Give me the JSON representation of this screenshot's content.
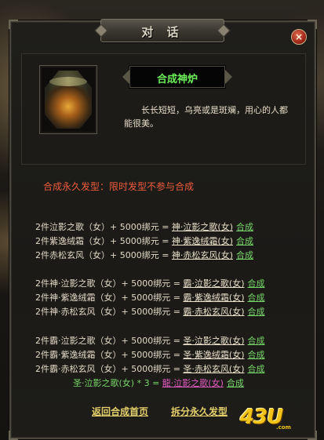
{
  "window": {
    "title": "对 话",
    "close_label": "×"
  },
  "npc": {
    "name": "合成神炉",
    "description": "长长短短，乌亮或是斑斓，用心的人都能很美。"
  },
  "notice": "合成永久发型：限时发型不参与合成",
  "recipe_groups": [
    [
      {
        "src": "2件泣影之歌（女）+ 5000绑元 = ",
        "result": "神·泣影之歌(女)",
        "action": "合成"
      },
      {
        "src": "2件紫逸绒霜（女）+ 5000绑元 = ",
        "result": "神·紫逸绒霜(女)",
        "action": "合成"
      },
      {
        "src": "2件赤松玄风（女）+ 5000绑元 = ",
        "result": "神·赤松玄风(女)",
        "action": "合成"
      }
    ],
    [
      {
        "src": "2件神·泣影之歌（女）+ 5000绑元 = ",
        "result": "霸·泣影之歌(女)",
        "action": "合成"
      },
      {
        "src": "2件神·紫逸绒霜（女）+ 5000绑元 = ",
        "result": "霸·紫逸绒霜(女)",
        "action": "合成"
      },
      {
        "src": "2件神·赤松玄风（女）+ 5000绑元 = ",
        "result": "霸·赤松玄风(女)",
        "action": "合成"
      }
    ],
    [
      {
        "src": "2件霸·泣影之歌（女）+ 5000绑元 = ",
        "result": "圣·泣影之歌(女)",
        "action": "合成"
      },
      {
        "src": "2件霸·紫逸绒霜（女）+ 5000绑元 = ",
        "result": "圣·紫逸绒霜(女)",
        "action": "合成"
      },
      {
        "src": "2件霸·赤松玄风（女）+ 5000绑元 = ",
        "result": "圣·赤松玄风(女)",
        "action": "合成"
      },
      {
        "src": "圣·泣影之歌(女) * 3 = ",
        "result": "龍·泣影之歌(女)",
        "action": "合成"
      }
    ]
  ],
  "footer": {
    "back_label": "返回合成首页",
    "split_label": "拆分永久发型"
  },
  "logo": {
    "main": "43U",
    "sub": ".com"
  },
  "colors": {
    "npc_name": "#6ef05a",
    "notice": "#ef5b3a",
    "link": "#e2ce6b",
    "dragon": "#e45ac3"
  }
}
